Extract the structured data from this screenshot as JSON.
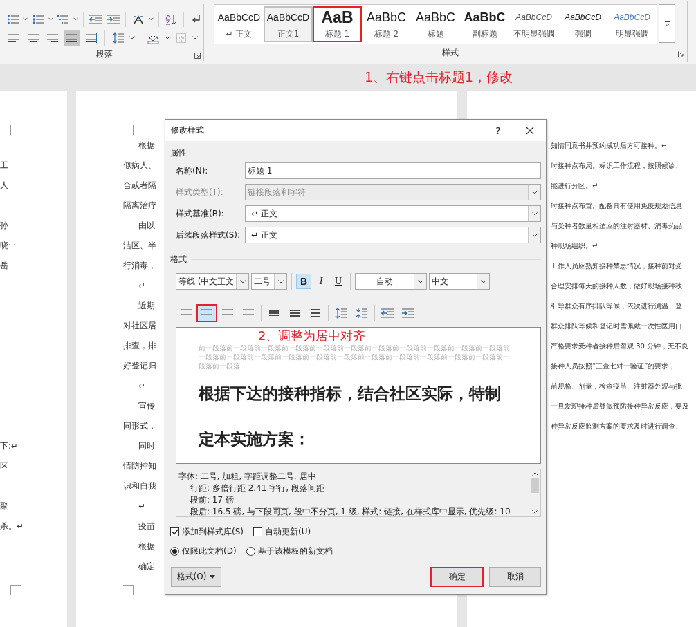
{
  "ribbon": {
    "paragraph_group": {
      "label": "段落",
      "alignment": [
        {
          "kind": "left",
          "selected": false
        },
        {
          "kind": "center",
          "selected": false
        },
        {
          "kind": "right",
          "selected": false
        },
        {
          "kind": "justify",
          "selected": true
        },
        {
          "kind": "distributed",
          "selected": false
        }
      ]
    },
    "styles_group": {
      "label": "样式",
      "gallery": [
        {
          "preview": "AaBbCcD",
          "label": "↵ 正文",
          "kind": "normal",
          "selected": false,
          "annotated": false
        },
        {
          "preview": "AaBbCcD",
          "label": "正文1",
          "kind": "normal",
          "selected": true,
          "annotated": false
        },
        {
          "preview": "AaB",
          "label": "标题 1",
          "kind": "heading1",
          "selected": false,
          "annotated": true
        },
        {
          "preview": "AaBbC",
          "label": "标题 2",
          "kind": "heading2",
          "selected": false,
          "annotated": false
        },
        {
          "preview": "AaBbC",
          "label": "标题",
          "kind": "title",
          "selected": false,
          "annotated": false
        },
        {
          "preview": "AaBbC",
          "label": "副标题",
          "kind": "subtitle",
          "selected": false,
          "annotated": false
        },
        {
          "preview": "AaBbCcD",
          "label": "不明显强调",
          "kind": "subtle",
          "selected": false,
          "annotated": false
        },
        {
          "preview": "AaBbCcD",
          "label": "强调",
          "kind": "emphasis",
          "selected": false,
          "annotated": false
        },
        {
          "preview": "AaBbCcD",
          "label": "明显强调",
          "kind": "intense",
          "selected": false,
          "annotated": false
        }
      ]
    }
  },
  "annotation": {
    "text": "1、右键点击标题1，修改"
  },
  "pages": [
    {
      "lines": [
        {
          "kind": "blank"
        },
        {
          "kind": "flush",
          "text": "工"
        },
        {
          "kind": "flush",
          "text": "人"
        },
        {
          "kind": "blank"
        },
        {
          "kind": "flush",
          "text": "孙"
        },
        {
          "kind": "flush",
          "text": "晓···"
        },
        {
          "kind": "flush",
          "text": "岳"
        },
        {
          "kind": "blank"
        },
        {
          "kind": "blank"
        },
        {
          "kind": "blank"
        },
        {
          "kind": "blank"
        },
        {
          "kind": "blank"
        },
        {
          "kind": "blank"
        },
        {
          "kind": "blank"
        },
        {
          "kind": "blank"
        },
        {
          "kind": "flush",
          "text": "下:↵"
        },
        {
          "kind": "flush",
          "text": "区"
        },
        {
          "kind": "blank"
        },
        {
          "kind": "flush",
          "text": "聚"
        },
        {
          "kind": "flush",
          "text": "杀。↵"
        }
      ]
    },
    {
      "lines": [
        {
          "kind": "indent",
          "text": "根据"
        },
        {
          "kind": "flush",
          "text": "似病人、"
        },
        {
          "kind": "flush",
          "text": "合或者隔"
        },
        {
          "kind": "flush",
          "text": "隔离治疗"
        },
        {
          "kind": "indent",
          "text": "由以"
        },
        {
          "kind": "flush",
          "text": "洁区、半"
        },
        {
          "kind": "flush",
          "text": "行消毒，"
        },
        {
          "kind": "indent",
          "text": "↵"
        },
        {
          "kind": "indent",
          "text": "近期"
        },
        {
          "kind": "flush",
          "text": "对社区居"
        },
        {
          "kind": "flush",
          "text": "排查，排"
        },
        {
          "kind": "flush",
          "text": "好登记归"
        },
        {
          "kind": "indent",
          "text": "↵"
        },
        {
          "kind": "indent",
          "text": "宣传"
        },
        {
          "kind": "flush",
          "text": "同形式，"
        },
        {
          "kind": "indent",
          "text": "同时"
        },
        {
          "kind": "flush",
          "text": "情防控知"
        },
        {
          "kind": "flush",
          "text": "识和自我"
        },
        {
          "kind": "indent",
          "text": "↵"
        },
        {
          "kind": "indent",
          "text": "疫苗"
        },
        {
          "kind": "indent",
          "text": "根据"
        },
        {
          "kind": "indent",
          "text": "确定"
        }
      ]
    },
    {
      "lines": [
        {
          "kind": "flush",
          "text": "知情同意书并预约成功后方可接种。↵"
        },
        {
          "kind": "flush",
          "text": "时接种点布局。标识工作流程，按照候诊、"
        },
        {
          "kind": "flush",
          "text": "能进行分区。↵"
        },
        {
          "kind": "flush",
          "text": "时接种点布置。配备具有使用免疫规划信息"
        },
        {
          "kind": "flush",
          "text": "与受种者数量相适应的注射器材、消毒药品"
        },
        {
          "kind": "flush",
          "text": "种现场组织。↵"
        },
        {
          "kind": "flush",
          "text": "工作人员应熟知接种禁忌情况，接种前对受"
        },
        {
          "kind": "flush",
          "text": "合理安排每天的接种人数，做好现场接种秩"
        },
        {
          "kind": "flush",
          "text": "引导群众有序排队等候，依次进行测温、登"
        },
        {
          "kind": "flush",
          "text": "群众排队等候和登记时需佩戴一次性医用口"
        },
        {
          "kind": "flush",
          "text": "严格要求受种者接种后留观 30 分钟，无不良"
        },
        {
          "kind": "flush",
          "text": "接种人员按照“三查七对一验证”的要求，"
        },
        {
          "kind": "flush",
          "text": "苗规格、剂量，检查疫苗、注射器外观与批"
        },
        {
          "kind": "flush",
          "text": "一旦发现接种后疑似预防接种异常反应，要及"
        },
        {
          "kind": "flush",
          "text": "种异常反应监测方案的要求及时进行调查、"
        }
      ]
    }
  ],
  "dialog": {
    "title": "修改样式",
    "help": "?",
    "properties": {
      "heading": "属性",
      "fields": [
        {
          "label": "名称(N):",
          "kind": "text",
          "value": "标题 1",
          "disabled": false
        },
        {
          "label": "样式类型(T):",
          "kind": "select",
          "value": "链接段落和字符",
          "disabled": true
        },
        {
          "label": "样式基准(B):",
          "kind": "select",
          "value": "↵ 正文",
          "disabled": false
        },
        {
          "label": "后续段落样式(S):",
          "kind": "select",
          "value": "↵ 正文",
          "disabled": false
        }
      ]
    },
    "format": {
      "heading": "格式",
      "font": "等线 (中文正文",
      "size": "二号",
      "styles": [
        {
          "label": "B",
          "kind": "bold",
          "selected": true
        },
        {
          "label": "I",
          "kind": "italic",
          "selected": false
        },
        {
          "label": "U",
          "kind": "underline",
          "selected": false
        }
      ],
      "color_picker": "自动",
      "script": "中文",
      "paragraph_tools": [
        {
          "kind": "left",
          "selected": false,
          "annotated": false
        },
        {
          "kind": "center",
          "selected": true,
          "annotated": true
        },
        {
          "kind": "right",
          "selected": false,
          "annotated": false
        },
        {
          "kind": "justify",
          "selected": false,
          "annotated": false
        },
        {
          "kind": "single",
          "selected": false,
          "annotated": false
        },
        {
          "kind": "one-half",
          "selected": false,
          "annotated": false
        },
        {
          "kind": "double",
          "selected": false,
          "annotated": false
        },
        {
          "kind": "space-more",
          "selected": false,
          "annotated": false
        },
        {
          "kind": "space-less",
          "selected": false,
          "annotated": false
        },
        {
          "kind": "outdent",
          "selected": false,
          "annotated": false
        },
        {
          "kind": "indent",
          "selected": false,
          "annotated": false
        }
      ]
    },
    "preview": {
      "previous_text": "前一段落前一段落前一段落前一段落前一段落前一段落前一段落前一段落前一段落前一段落前一段落前一段落前一段落前一段落前一段落前一段落前一段落前一段落前一段落前一段落前一段落前一段落前一段落前一段落",
      "sample": "根据下达的接种指标，结合社区实际，特制定本实施方案：",
      "annotation": "2、调整为居中对齐"
    },
    "description": [
      "字体: 二号, 加粗, 字距调整二号, 居中",
      "行距: 多倍行距 2.41 字行, 段落间距",
      "段前: 17 磅",
      "段后: 16.5 磅, 与下段同页, 段中不分页, 1 级, 样式: 链接, 在样式库中显示, 优先级: 10"
    ],
    "checkboxes": [
      {
        "label": "添加到样式库(S)",
        "checked": true
      },
      {
        "label": "自动更新(U)",
        "checked": false
      }
    ],
    "radios": [
      {
        "label": "仅限此文档(D)",
        "selected": true
      },
      {
        "label": "基于该模板的新文档",
        "selected": false
      }
    ],
    "format_button": "格式(O)",
    "buttons": [
      {
        "label": "确定",
        "annotated": true
      },
      {
        "label": "取消",
        "annotated": false
      }
    ]
  }
}
